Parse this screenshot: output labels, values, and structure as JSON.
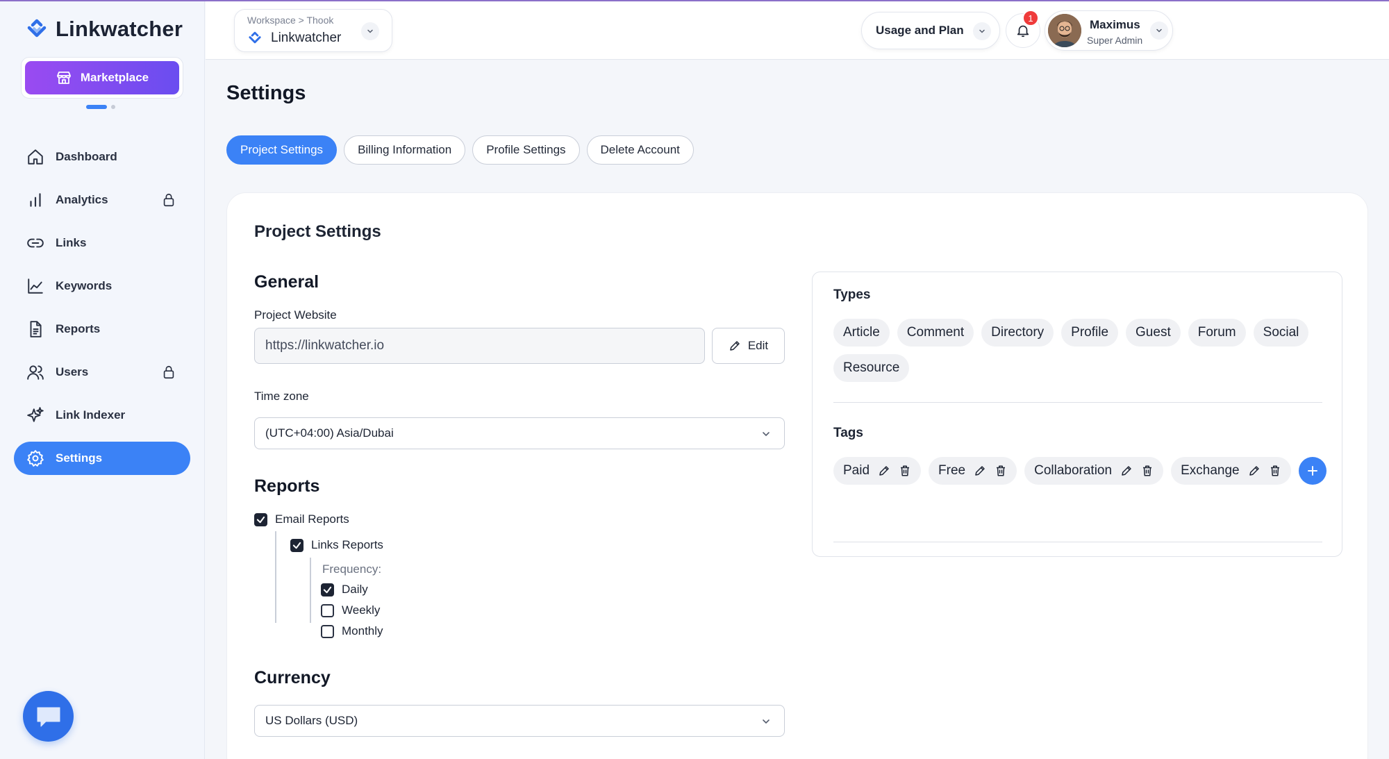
{
  "brand": {
    "name": "Linkwatcher"
  },
  "sidebar": {
    "marketplace_label": "Marketplace",
    "items": [
      {
        "label": "Dashboard",
        "icon": "home-icon",
        "locked": false,
        "active": false
      },
      {
        "label": "Analytics",
        "icon": "bar-chart-icon",
        "locked": true,
        "active": false
      },
      {
        "label": "Links",
        "icon": "link-icon",
        "locked": false,
        "active": false
      },
      {
        "label": "Keywords",
        "icon": "line-chart-icon",
        "locked": false,
        "active": false
      },
      {
        "label": "Reports",
        "icon": "document-icon",
        "locked": false,
        "active": false
      },
      {
        "label": "Users",
        "icon": "users-icon",
        "locked": true,
        "active": false
      },
      {
        "label": "Link Indexer",
        "icon": "sparkle-icon",
        "locked": false,
        "active": false
      },
      {
        "label": "Settings",
        "icon": "gear-icon",
        "locked": false,
        "active": true
      }
    ]
  },
  "header": {
    "workspace_crumb": "Workspace > Thook",
    "workspace_name": "Linkwatcher",
    "usage_label": "Usage and Plan",
    "notification_count": "1",
    "user_name": "Maximus",
    "user_role": "Super Admin"
  },
  "page": {
    "title": "Settings",
    "tabs": [
      {
        "label": "Project Settings",
        "active": true
      },
      {
        "label": "Billing Information",
        "active": false
      },
      {
        "label": "Profile Settings",
        "active": false
      },
      {
        "label": "Delete Account",
        "active": false
      }
    ]
  },
  "project": {
    "card_title": "Project Settings",
    "general_heading": "General",
    "website_label": "Project Website",
    "website_value": "https://linkwatcher.io",
    "edit_label": "Edit",
    "timezone_label": "Time zone",
    "timezone_value": "(UTC+04:00) Asia/Dubai",
    "reports_heading": "Reports",
    "email_reports_label": "Email Reports",
    "email_reports_checked": true,
    "links_reports_label": "Links Reports",
    "links_reports_checked": true,
    "frequency_label": "Frequency:",
    "frequency_options": [
      {
        "label": "Daily",
        "checked": true
      },
      {
        "label": "Weekly",
        "checked": false
      },
      {
        "label": "Monthly",
        "checked": false
      }
    ],
    "currency_heading": "Currency",
    "currency_value": "US Dollars (USD)",
    "types_heading": "Types",
    "types": [
      "Article",
      "Comment",
      "Directory",
      "Profile",
      "Guest",
      "Forum",
      "Social",
      "Resource"
    ],
    "tags_heading": "Tags",
    "tags": [
      "Paid",
      "Free",
      "Collaboration",
      "Exchange"
    ]
  },
  "colors": {
    "accent": "#3b82f6",
    "marketplace_from": "#9a4bf1",
    "marketplace_to": "#6a4df0",
    "badge": "#ef3b3b"
  }
}
